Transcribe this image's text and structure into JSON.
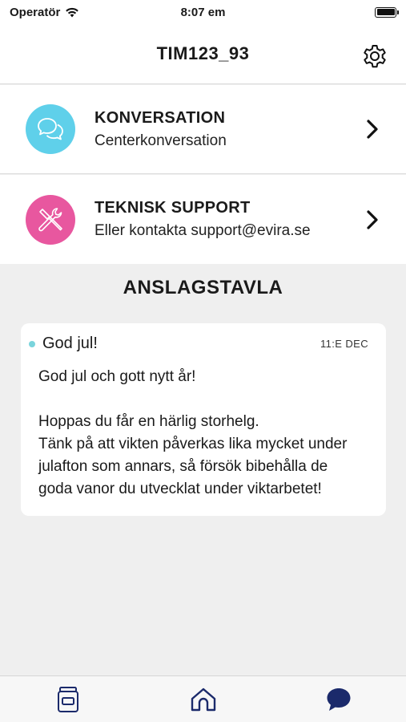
{
  "status_bar": {
    "carrier": "Operatör",
    "time": "8:07 em",
    "icons": [
      "wifi-icon",
      "battery-icon"
    ]
  },
  "header": {
    "title": "TIM123_93",
    "settings_icon": "gear-icon"
  },
  "menu": [
    {
      "title": "KONVERSATION",
      "subtitle": "Centerkonversation",
      "icon": "chat-bubbles-icon",
      "icon_color": "#5fd0ea"
    },
    {
      "title": "TEKNISK SUPPORT",
      "subtitle": "Eller kontakta support@evira.se",
      "icon": "tools-icon",
      "icon_color": "#e8579f"
    }
  ],
  "board": {
    "title": "ANSLAGSTAVLA",
    "messages": [
      {
        "subject": "God jul!",
        "date": "11:E DEC",
        "unread_dot_color": "#7ad4dc",
        "body_line1": "God jul och gott nytt år!",
        "body_line2": "Hoppas du får en härlig storhelg.",
        "body_line3": "Tänk på att vikten påverkas lika mycket under",
        "body_line4": "julafton som annars, så försök bibehålla de",
        "body_line5": "goda vanor du utvecklat under viktarbetet!"
      }
    ]
  },
  "tab_bar": {
    "tabs": [
      {
        "icon": "diary-jar-icon",
        "active": false
      },
      {
        "icon": "home-icon",
        "active": false
      },
      {
        "icon": "chat-icon",
        "active": true
      }
    ],
    "accent_color": "#1b2a6b"
  }
}
